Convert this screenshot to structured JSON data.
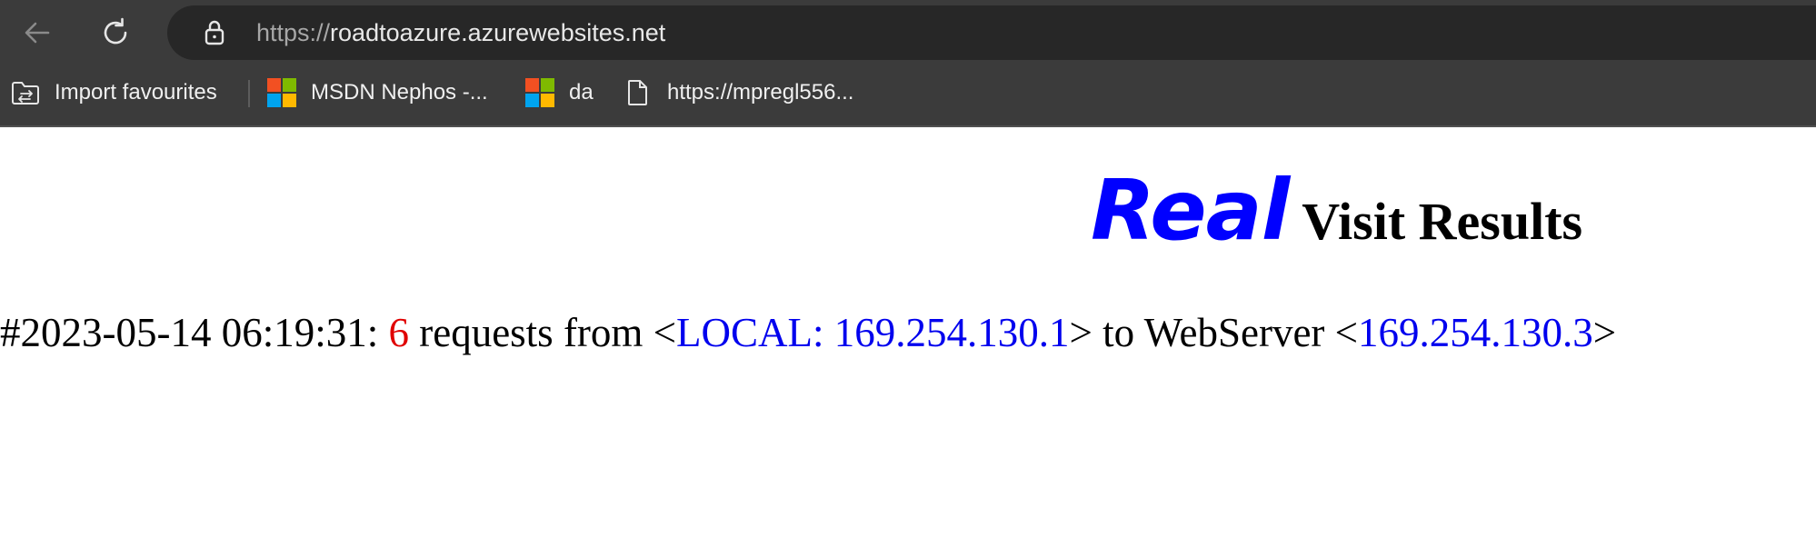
{
  "browser": {
    "url_scheme": "https://",
    "url_host": "roadtoazure.azurewebsites.net",
    "bookmarks": [
      {
        "label": "Import favourites",
        "icon": "folder-import-icon"
      },
      {
        "label": "MSDN Nephos -...",
        "icon": "microsoft-logo-icon"
      },
      {
        "label": "da",
        "icon": "microsoft-logo-icon"
      },
      {
        "label": "https://mpregl556...",
        "icon": "page-icon"
      }
    ]
  },
  "colors": {
    "chrome_bg": "#3b3b3b",
    "address_bg": "#272727",
    "heading_accent": "#0000ff",
    "count_red": "#e00000",
    "link_blue": "#0000ee",
    "ms_red": "#f25022",
    "ms_green": "#7fba00",
    "ms_blue": "#00a4ef",
    "ms_yellow": "#ffb900"
  },
  "page": {
    "heading_accent": "Real",
    "heading_rest": "Visit Results",
    "visit": {
      "prefix": "#2023-05-14 06:19:31: ",
      "count": "6",
      "text_requests_from": " requests from <",
      "source": "LOCAL: 169.254.130.1",
      "text_to_server": "> to WebServer <",
      "server": "169.254.130.3",
      "suffix": ">"
    }
  }
}
